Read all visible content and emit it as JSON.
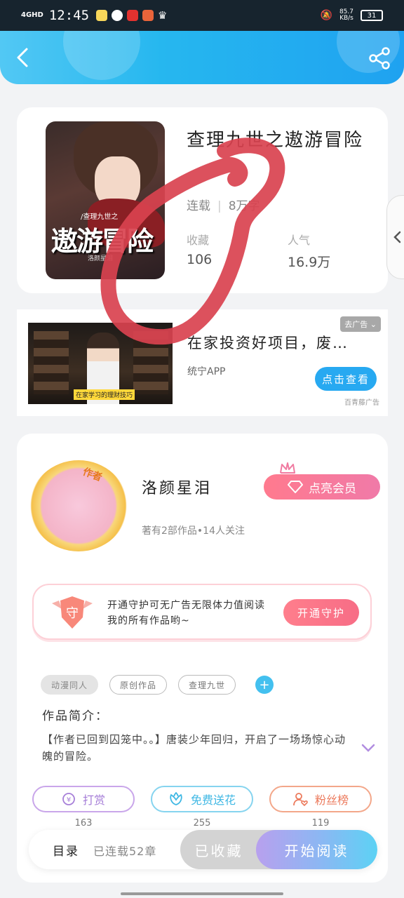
{
  "status_bar": {
    "network": "4GHD",
    "time": "12:45",
    "speed": "85.7",
    "speed_unit": "KB/s",
    "battery": "31"
  },
  "header": {
    "back_icon": "chevron-left-icon",
    "share_icon": "share-icon"
  },
  "book": {
    "cover_subtitle": "/查理九世之",
    "cover_title": "遨游冒险",
    "cover_author": "洛颜星泪",
    "title": "查理九世之遨游冒险",
    "status": "连载",
    "word_count": "8万字",
    "favorites_label": "收藏",
    "favorites_value": "106",
    "popularity_label": "人气",
    "popularity_value": "16.9万"
  },
  "ad": {
    "tag": "去广告",
    "title": "在家投资好项目，废…",
    "source": "统宁APP",
    "button": "点击查看",
    "provider": "百青藤广告",
    "thumb_caption": "在家学习的理财技巧"
  },
  "author": {
    "badge": "作者",
    "name": "洛颜星泪",
    "meta": "著有2部作品•14人关注",
    "vip_button": "点亮会员"
  },
  "guard": {
    "shield_text": "守",
    "text": "开通守护可无广告无限体力值阅读我的所有作品哟~",
    "button": "开通守护"
  },
  "tags": [
    "动漫同人",
    "原创作品",
    "查理九世"
  ],
  "intro": {
    "label": "作品简介：",
    "text": "【作者已回到囚笼中。。】唐装少年回归，开启了一场场惊心动魄的冒险。"
  },
  "actions": [
    {
      "label": "打赏",
      "count": "163",
      "icon": "yen-coin-icon"
    },
    {
      "label": "免费送花",
      "count": "255",
      "icon": "flower-icon"
    },
    {
      "label": "粉丝榜",
      "count": "119",
      "icon": "fans-icon"
    }
  ],
  "bottom": {
    "toc": "目录",
    "chapters": "已连载52章",
    "fav_button": "已收藏",
    "read_button": "开始阅读"
  },
  "colors": {
    "header": "#26b7ef",
    "accent_pink": "#ff7a8e",
    "annotation_red": "#d9424f"
  }
}
